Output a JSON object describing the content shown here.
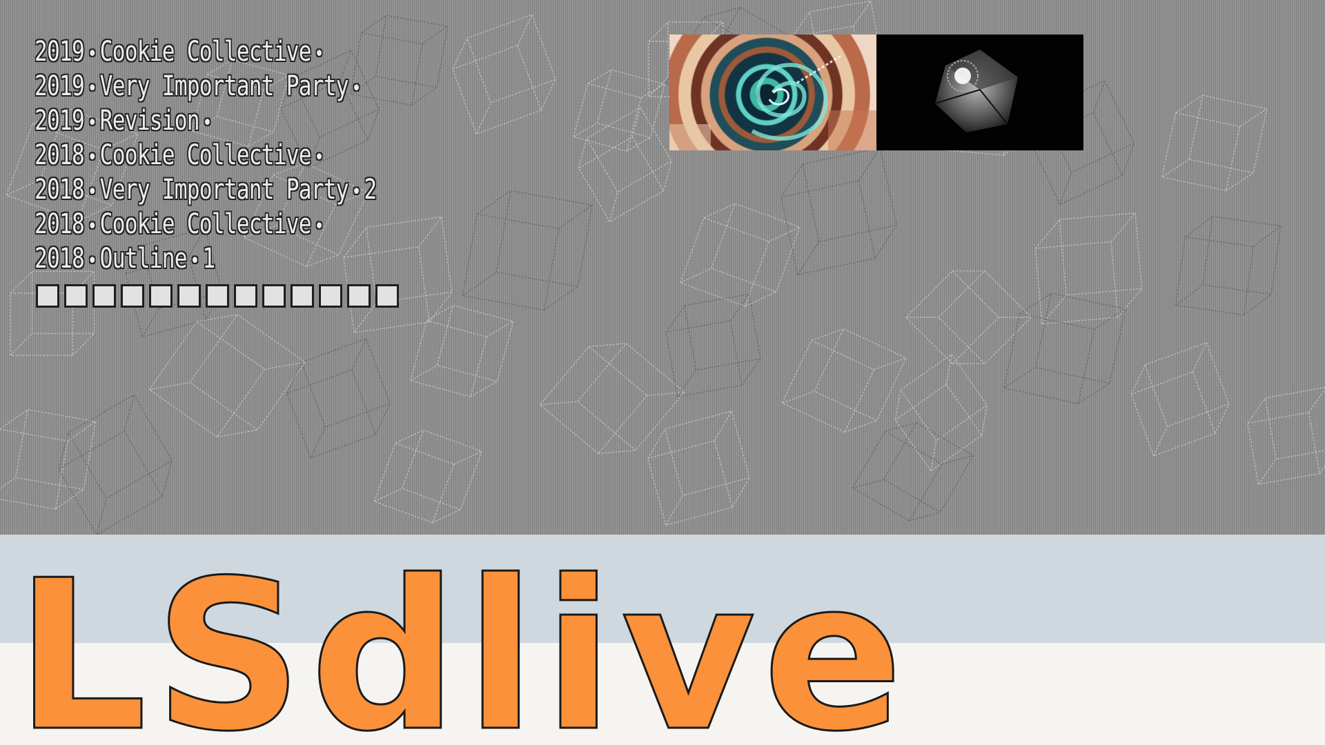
{
  "events": [
    {
      "year": "2019",
      "party": "Cookie Collective",
      "place": ""
    },
    {
      "year": "2019",
      "party": "Very Important Party",
      "place": ""
    },
    {
      "year": "2019",
      "party": "Revision",
      "place": ""
    },
    {
      "year": "2018",
      "party": "Cookie Collective",
      "place": ""
    },
    {
      "year": "2018",
      "party": "Very Important Party",
      "place": "2"
    },
    {
      "year": "2018",
      "party": "Cookie Collective",
      "place": ""
    },
    {
      "year": "2018",
      "party": "Outline",
      "place": "1"
    }
  ],
  "separator": "•",
  "progress": {
    "total": 13,
    "filled": 13
  },
  "logo_text": "LSdlive",
  "colors": {
    "background": "#8d8d8d",
    "band_top": "#cfd8de",
    "band_bottom": "#f5f4f1",
    "logo_fill": "#fb913a",
    "text": "#ececec"
  }
}
